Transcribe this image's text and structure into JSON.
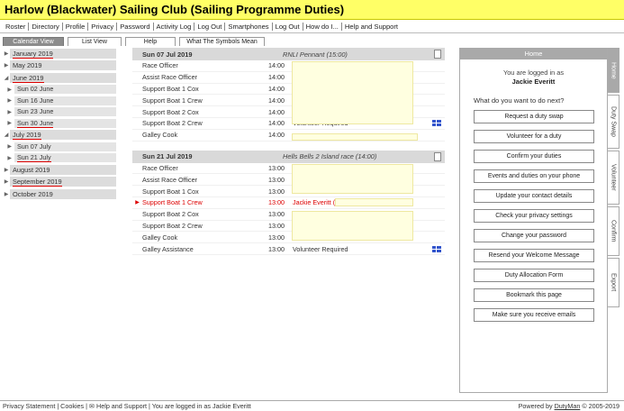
{
  "app_title": "Harlow (Blackwater) Sailing Club (Sailing Programme Duties)",
  "menu": [
    "Roster",
    "Directory",
    "Profile",
    "Privacy",
    "Password",
    "Activity Log",
    "Log Out",
    "Smartphones",
    "Log Out",
    "How do I...",
    "Help and Support"
  ],
  "tabs": [
    {
      "label": "Calendar View",
      "active": true
    },
    {
      "label": "List View",
      "active": false
    },
    {
      "label": "Help",
      "active": false
    },
    {
      "label": "What The Symbols Mean",
      "active": false
    }
  ],
  "months": [
    {
      "type": "month",
      "label": "January 2019",
      "expanded": false,
      "selected": true
    },
    {
      "type": "month",
      "label": "May 2019",
      "expanded": false,
      "selected": false
    },
    {
      "type": "month",
      "label": "June 2019",
      "expanded": true,
      "selected": true
    },
    {
      "type": "week",
      "label": "Sun 02 June",
      "selected": false
    },
    {
      "type": "week",
      "label": "Sun 16 June",
      "selected": false
    },
    {
      "type": "week",
      "label": "Sun 23 June",
      "selected": false
    },
    {
      "type": "week",
      "label": "Sun 30 June",
      "selected": true
    },
    {
      "type": "month",
      "label": "July 2019",
      "expanded": true,
      "selected": true
    },
    {
      "type": "week",
      "label": "Sun 07 July",
      "selected": false
    },
    {
      "type": "week",
      "label": "Sun 21 July",
      "selected": true
    },
    {
      "type": "month",
      "label": "August 2019",
      "expanded": false,
      "selected": false
    },
    {
      "type": "month",
      "label": "September 2019",
      "expanded": false,
      "selected": true
    },
    {
      "type": "month",
      "label": "October 2019",
      "expanded": false,
      "selected": false
    }
  ],
  "events": [
    {
      "date": "Sun 07 Jul 2019",
      "name": "RNLI Pennant (15:00)",
      "duties": [
        {
          "role": "Race Officer",
          "time": "14:00",
          "person": "",
          "highlight": false
        },
        {
          "role": "Assist Race Officer",
          "time": "14:00",
          "person": "",
          "highlight": false
        },
        {
          "role": "Support Boat 1 Cox",
          "time": "14:00",
          "person": "",
          "highlight": false
        },
        {
          "role": "Support Boat 1 Crew",
          "time": "14:00",
          "person": "",
          "highlight": false
        },
        {
          "role": "Support Boat 2 Cox",
          "time": "14:00",
          "person": "",
          "highlight": false
        },
        {
          "role": "Support Boat 2 Crew",
          "time": "14:00",
          "person": "Volunteer Required",
          "highlight": false,
          "flag": true
        },
        {
          "role": "Galley Cook",
          "time": "14:00",
          "person": "",
          "highlight": false
        }
      ]
    },
    {
      "date": "Sun 21 Jul 2019",
      "name": "Hells Bells 2 Island race (14:00)",
      "duties": [
        {
          "role": "Race Officer",
          "time": "13:00",
          "person": "",
          "highlight": false
        },
        {
          "role": "Assist Race Officer",
          "time": "13:00",
          "person": "",
          "highlight": false
        },
        {
          "role": "Support Boat 1 Cox",
          "time": "13:00",
          "person": "",
          "highlight": false
        },
        {
          "role": "Support Boat 1 Crew",
          "time": "13:00",
          "person": "Jackie Everitt (",
          "highlight": true
        },
        {
          "role": "Support Boat 2 Cox",
          "time": "13:00",
          "person": "",
          "highlight": false
        },
        {
          "role": "Support Boat 2 Crew",
          "time": "13:00",
          "person": "",
          "highlight": false
        },
        {
          "role": "Galley Cook",
          "time": "13:00",
          "person": "",
          "highlight": false
        },
        {
          "role": "Galley Assistance",
          "time": "13:00",
          "person": "Volunteer Required",
          "highlight": false,
          "flag": true
        }
      ]
    }
  ],
  "right_panel": {
    "header": "Home",
    "logged_in_text": "You are logged in as",
    "user_name": "Jackie Everitt",
    "question": "What do you want to do next?",
    "actions": [
      "Request a duty swap",
      "Volunteer for a duty",
      "Confirm your duties",
      "Events and duties on your phone",
      "Update your contact details",
      "Check your privacy settings",
      "Change your password",
      "Resend your Welcome Message",
      "Duty Allocation Form",
      "Bookmark this page",
      "Make sure you receive emails"
    ]
  },
  "side_tabs": [
    {
      "label": "Home",
      "active": true
    },
    {
      "label": "Duty Swap",
      "active": false
    },
    {
      "label": "Volunteer",
      "active": false
    },
    {
      "label": "Confirm",
      "active": false
    },
    {
      "label": "Export",
      "active": false
    }
  ],
  "footer": {
    "links": "Privacy Statement | Cookies | ✉ Help and Support | You are logged in as Jackie Everitt",
    "powered_prefix": "Powered by ",
    "powered_link": "DutyMan",
    "powered_suffix": " © 2005-2019"
  }
}
